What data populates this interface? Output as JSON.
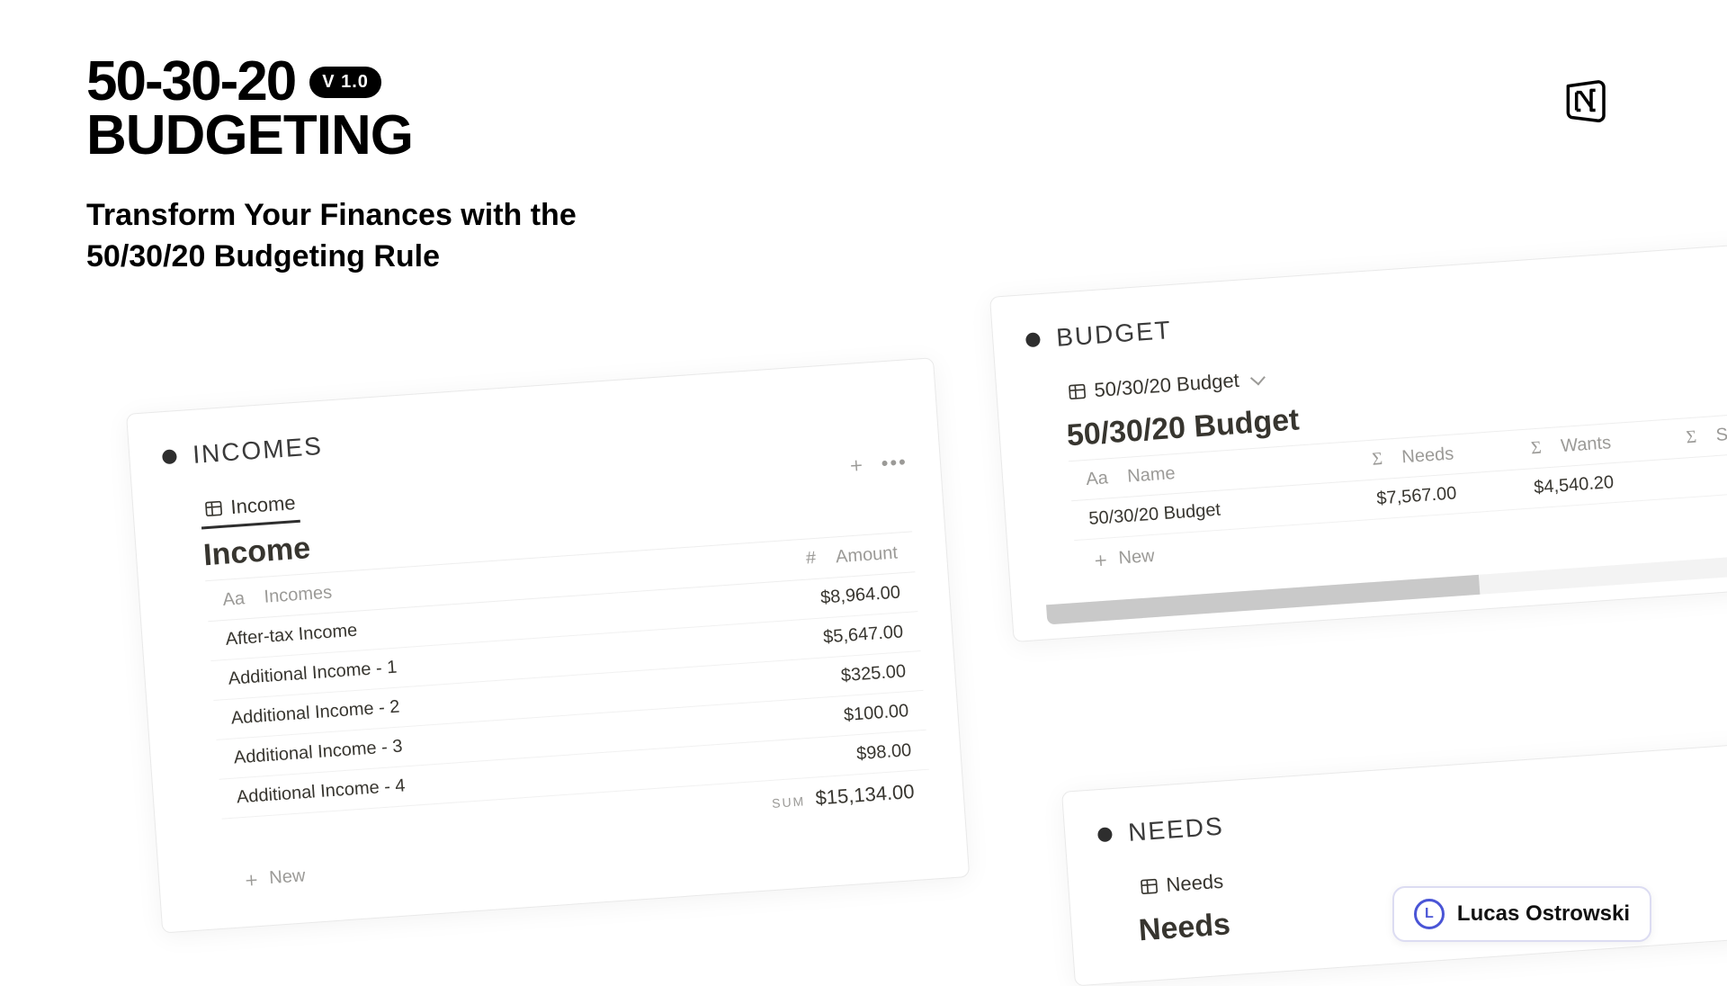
{
  "header": {
    "title_top": "50-30-20",
    "title_bottom": "BUDGETING",
    "version": "V 1.0",
    "tagline_l1": "Transform Your Finances with the",
    "tagline_l2": "50/30/20 Budgeting Rule"
  },
  "incomes": {
    "section_label": "INCOMES",
    "tab": "Income",
    "title": "Income",
    "col_name": "Incomes",
    "col_name_prefix": "Aa",
    "col_amount": "Amount",
    "col_amount_prefix": "#",
    "rows": [
      {
        "name": "After-tax Income",
        "amount": "$8,964.00"
      },
      {
        "name": "Additional Income - 1",
        "amount": "$5,647.00"
      },
      {
        "name": "Additional Income - 2",
        "amount": "$325.00"
      },
      {
        "name": "Additional Income - 3",
        "amount": "$100.00"
      },
      {
        "name": "Additional Income - 4",
        "amount": "$98.00"
      }
    ],
    "sum_label": "SUM",
    "sum_value": "$15,134.00",
    "new_label": "New"
  },
  "budget": {
    "section_label": "BUDGET",
    "tab": "50/30/20 Budget",
    "title": "50/30/20 Budget",
    "col_name_prefix": "Aa",
    "col_name": "Name",
    "col_needs_prefix": "Σ",
    "col_needs": "Needs",
    "col_wants_prefix": "Σ",
    "col_wants": "Wants",
    "col_savings_prefix": "Σ",
    "col_savings": "Savin",
    "row": {
      "name": "50/30/20 Budget",
      "needs": "$7,567.00",
      "wants": "$4,540.20"
    },
    "new_label": "New"
  },
  "needs": {
    "section_label": "NEEDS",
    "tab": "Needs",
    "title": "Needs"
  },
  "author": {
    "initial": "L",
    "name": "Lucas Ostrowski"
  }
}
